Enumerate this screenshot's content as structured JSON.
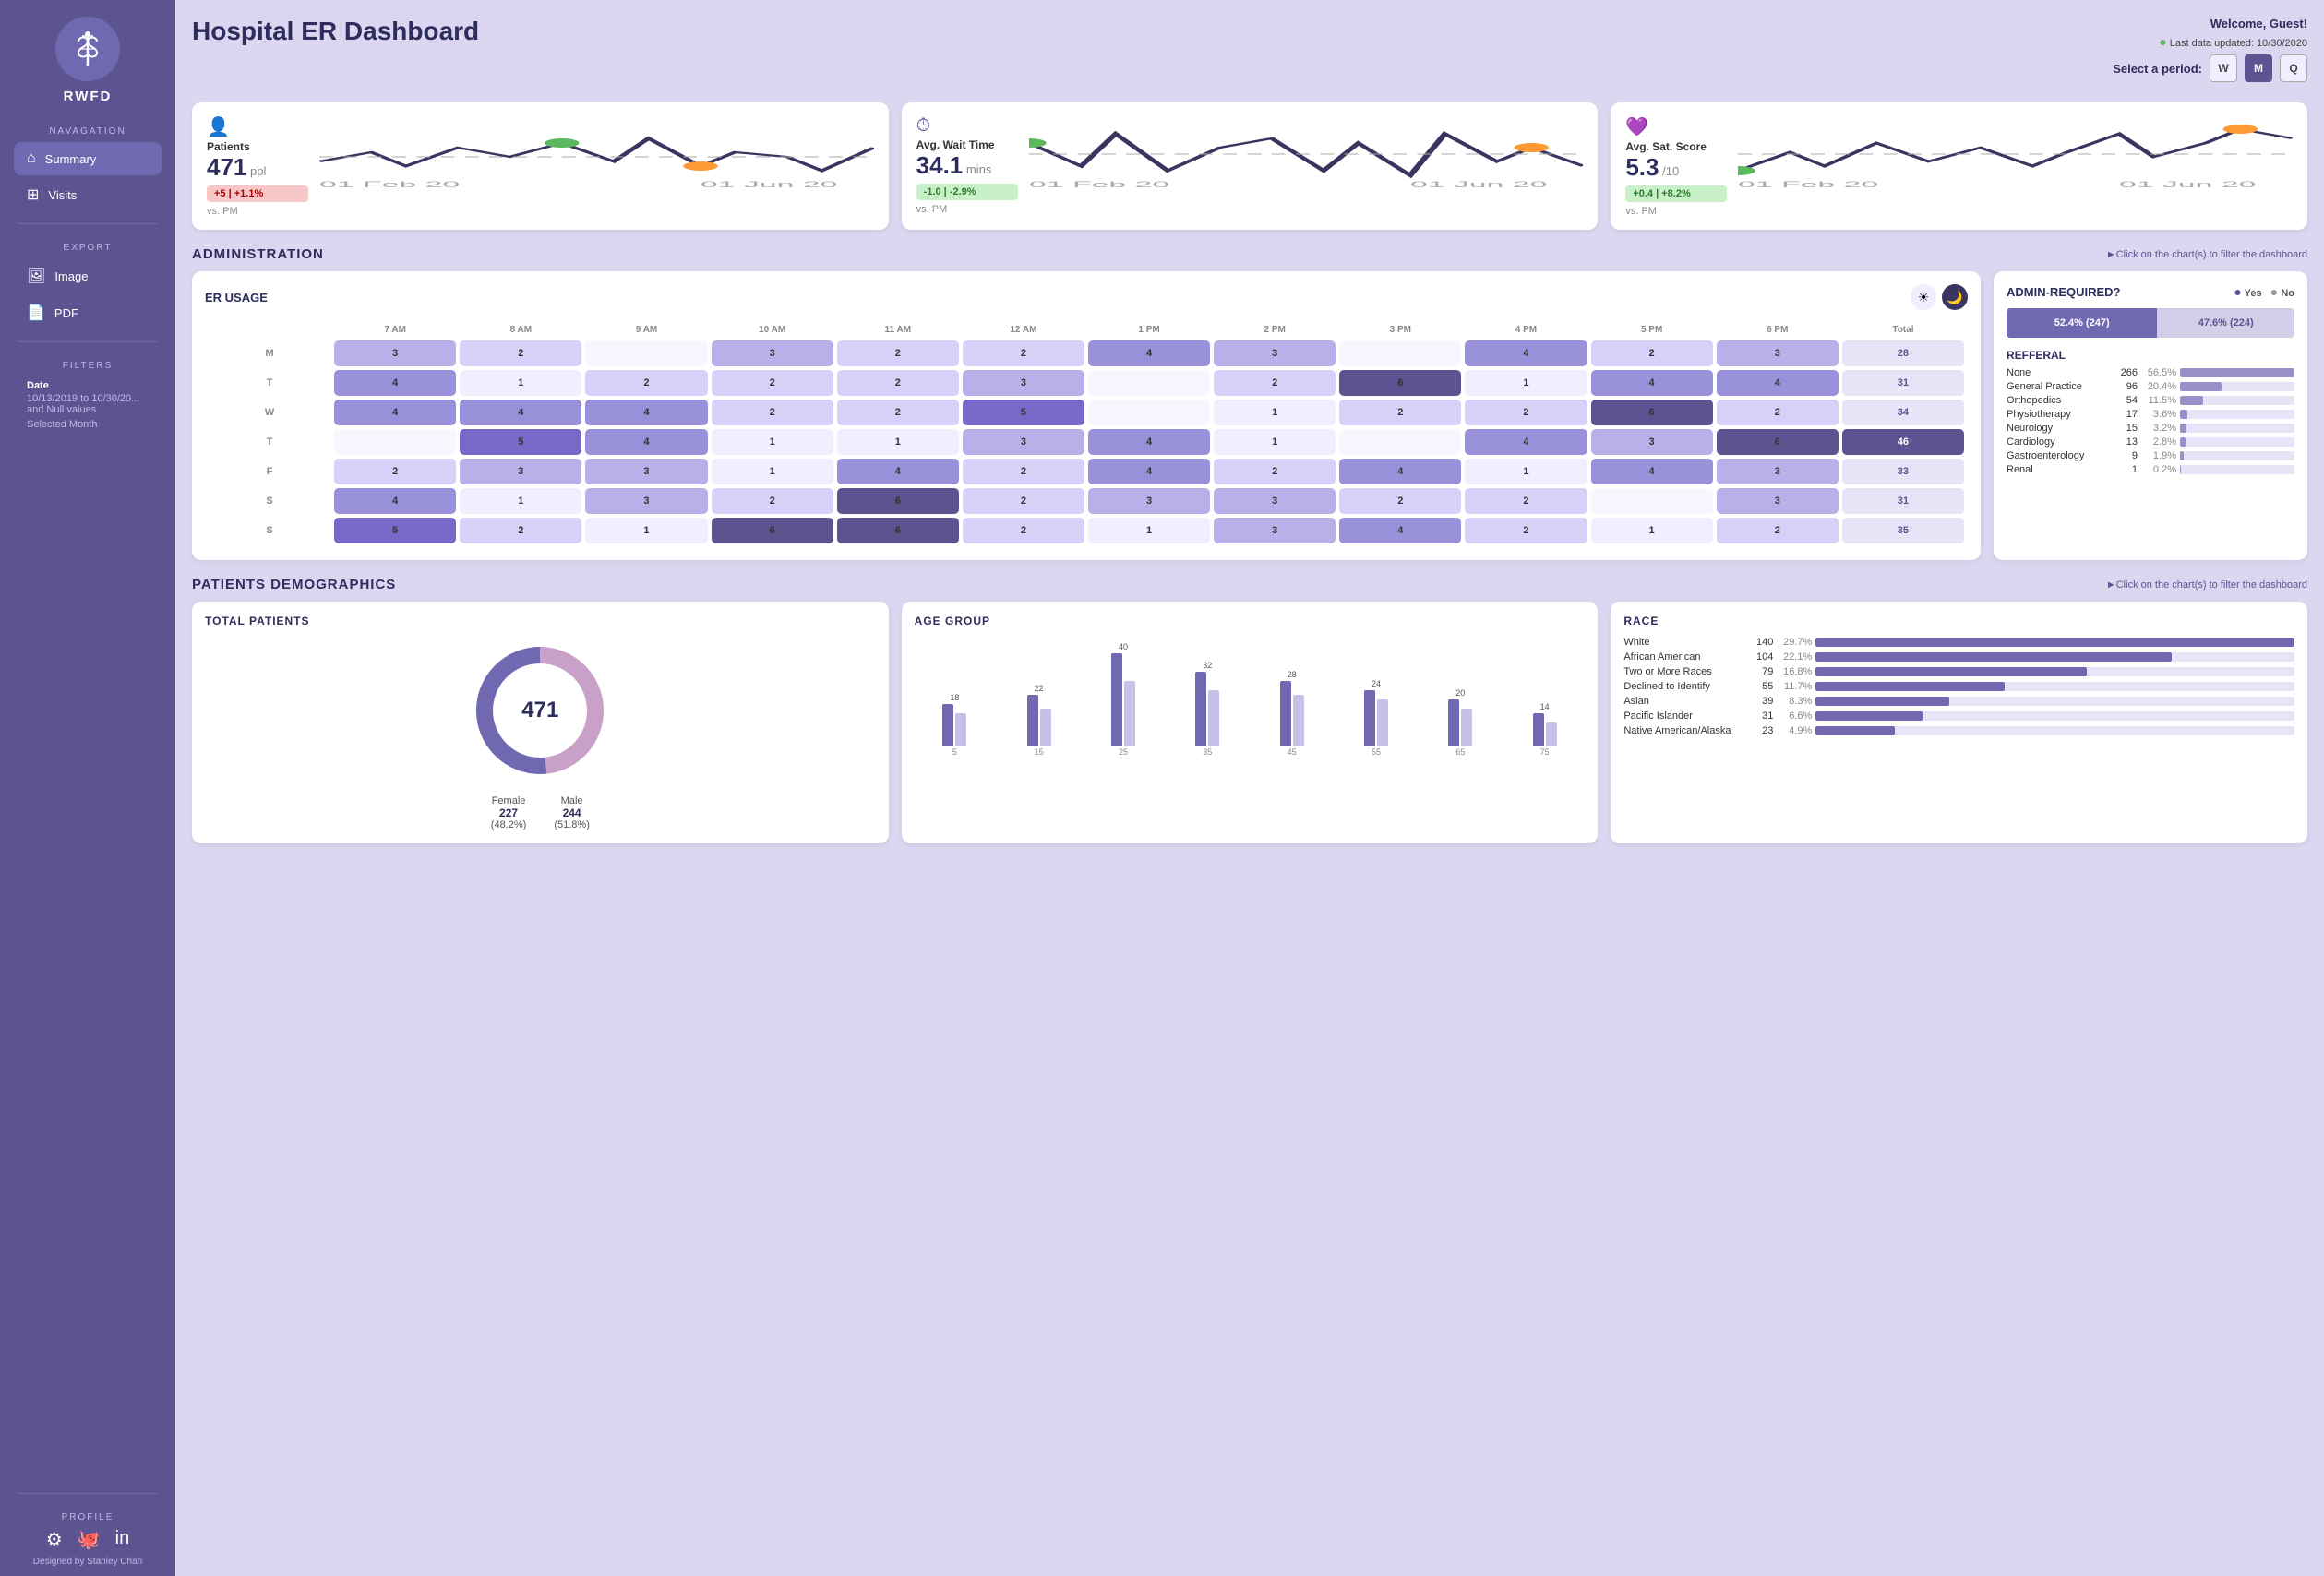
{
  "sidebar": {
    "brand": "RWFD",
    "nav_label": "NAVAGATION",
    "export_label": "EXPORT",
    "filters_label": "FILTERS",
    "profile_label": "PROFILE",
    "nav_items": [
      {
        "id": "summary",
        "label": "Summary",
        "active": true
      },
      {
        "id": "visits",
        "label": "Visits",
        "active": false
      }
    ],
    "export_items": [
      {
        "id": "image",
        "label": "Image"
      },
      {
        "id": "pdf",
        "label": "PDF"
      }
    ],
    "filters": {
      "date_label": "Date",
      "date_value": "10/13/2019 to 10/30/20...",
      "null_note": "and Null values",
      "month_label": "Selected Month"
    },
    "credit": "Designed by Stanley Chan"
  },
  "header": {
    "title": "Hospital ER Dashboard",
    "welcome": "Welcome, Guest!",
    "last_updated": "Last data updated: 10/30/2020",
    "period_label": "Select a period:",
    "periods": [
      "W",
      "M",
      "Q"
    ],
    "active_period": "M"
  },
  "kpi": [
    {
      "icon": "👤",
      "label": "Patients",
      "value": "471",
      "unit": "ppl",
      "badge": "+5 | +1.1%",
      "badge_type": "red",
      "vs": "vs. PM",
      "chart_dates": [
        "01 Feb 20",
        "01 Jun 20"
      ]
    },
    {
      "icon": "⏱",
      "label": "Avg. Wait Time",
      "value": "34.1",
      "unit": "mins",
      "badge": "-1.0 | -2.9%",
      "badge_type": "green",
      "vs": "vs. PM",
      "chart_dates": [
        "01 Feb 20",
        "01 Jun 20"
      ]
    },
    {
      "icon": "💜",
      "label": "Avg. Sat. Score",
      "value": "5.3",
      "unit": "/10",
      "badge": "+0.4 | +8.2%",
      "badge_type": "green",
      "vs": "vs. PM",
      "chart_dates": [
        "01 Feb 20",
        "01 Jun 20"
      ]
    }
  ],
  "administration": {
    "title": "ADMINISTRATION",
    "hint": "►Click on the chart(s) to filter the dashboard",
    "er_usage": {
      "title": "ER USAGE",
      "hours": [
        "7 AM",
        "8 AM",
        "9 AM",
        "10 AM",
        "11 AM",
        "12 AM",
        "1 PM",
        "2 PM",
        "3 PM",
        "4 PM",
        "5 PM",
        "6 PM",
        "Total"
      ],
      "rows": [
        {
          "day": "M",
          "cells": [
            3,
            2,
            0,
            3,
            2,
            2,
            4,
            3,
            0,
            4,
            2,
            3
          ],
          "total": 28,
          "highlight": false
        },
        {
          "day": "T",
          "cells": [
            4,
            1,
            2,
            2,
            2,
            3,
            0,
            2,
            6,
            1,
            4,
            4
          ],
          "total": 31,
          "highlight": false
        },
        {
          "day": "W",
          "cells": [
            4,
            4,
            4,
            2,
            2,
            5,
            0,
            1,
            2,
            2,
            6,
            2
          ],
          "total": 34,
          "highlight": false
        },
        {
          "day": "T",
          "cells": [
            0,
            5,
            4,
            1,
            1,
            3,
            4,
            1,
            0,
            4,
            3,
            6
          ],
          "total": 46,
          "highlight": true
        },
        {
          "day": "F",
          "cells": [
            2,
            3,
            3,
            1,
            4,
            2,
            4,
            2,
            4,
            1,
            4,
            3
          ],
          "total": 33,
          "highlight": false
        },
        {
          "day": "S",
          "cells": [
            4,
            1,
            3,
            2,
            6,
            2,
            3,
            3,
            2,
            2,
            0,
            3
          ],
          "total": 31,
          "highlight": false
        },
        {
          "day": "S",
          "cells": [
            5,
            2,
            1,
            6,
            6,
            2,
            1,
            3,
            4,
            2,
            1,
            2
          ],
          "total": 35,
          "highlight": false
        }
      ]
    },
    "admin_required": {
      "title": "ADMIN-REQUIRED?",
      "yes_pct": 52.4,
      "yes_count": 247,
      "no_pct": 47.6,
      "no_count": 224,
      "legend_yes": "Yes",
      "legend_no": "No"
    },
    "referral": {
      "title": "REFFERAL",
      "items": [
        {
          "name": "None",
          "count": 266,
          "pct": 56.5
        },
        {
          "name": "General Practice",
          "count": 96,
          "pct": 20.4
        },
        {
          "name": "Orthopedics",
          "count": 54,
          "pct": 11.5
        },
        {
          "name": "Physiotherapy",
          "count": 17,
          "pct": 3.6
        },
        {
          "name": "Neurology",
          "count": 15,
          "pct": 3.2
        },
        {
          "name": "Cardiology",
          "count": 13,
          "pct": 2.8
        },
        {
          "name": "Gastroenterology",
          "count": 9,
          "pct": 1.9
        },
        {
          "name": "Renal",
          "count": 1,
          "pct": 0.2
        }
      ]
    }
  },
  "demographics": {
    "title": "PATIENTS DEMOGRAPHICS",
    "hint": "►Click on the chart(s) to filter the dashboard",
    "total_patients": {
      "title": "TOTAL PATIENTS",
      "total": 471,
      "female_count": 227,
      "female_pct": 48.2,
      "male_count": 244,
      "male_pct": 51.8
    },
    "age_group": {
      "title": "AGE GROUP",
      "bars": [
        {
          "label": "5",
          "val1": 18,
          "val2": 14
        },
        {
          "label": "15",
          "val1": 22,
          "val2": 16
        },
        {
          "label": "25",
          "val1": 40,
          "val2": 28
        },
        {
          "label": "35",
          "val1": 32,
          "val2": 24
        },
        {
          "label": "45",
          "val1": 28,
          "val2": 22
        },
        {
          "label": "55",
          "val1": 24,
          "val2": 20
        },
        {
          "label": "65",
          "val1": 20,
          "val2": 16
        },
        {
          "label": "75",
          "val1": 14,
          "val2": 10
        }
      ],
      "max": 40
    },
    "race": {
      "title": "RACE",
      "items": [
        {
          "name": "White",
          "count": 140,
          "pct": 29.7
        },
        {
          "name": "African American",
          "count": 104,
          "pct": 22.1
        },
        {
          "name": "Two or More Races",
          "count": 79,
          "pct": 16.8
        },
        {
          "name": "Declined to Identify",
          "count": 55,
          "pct": 11.7
        },
        {
          "name": "Asian",
          "count": 39,
          "pct": 8.3
        },
        {
          "name": "Pacific Islander",
          "count": 31,
          "pct": 6.6
        },
        {
          "name": "Native American/Alaska",
          "count": 23,
          "pct": 4.9
        }
      ],
      "max_pct": 29.7
    }
  }
}
